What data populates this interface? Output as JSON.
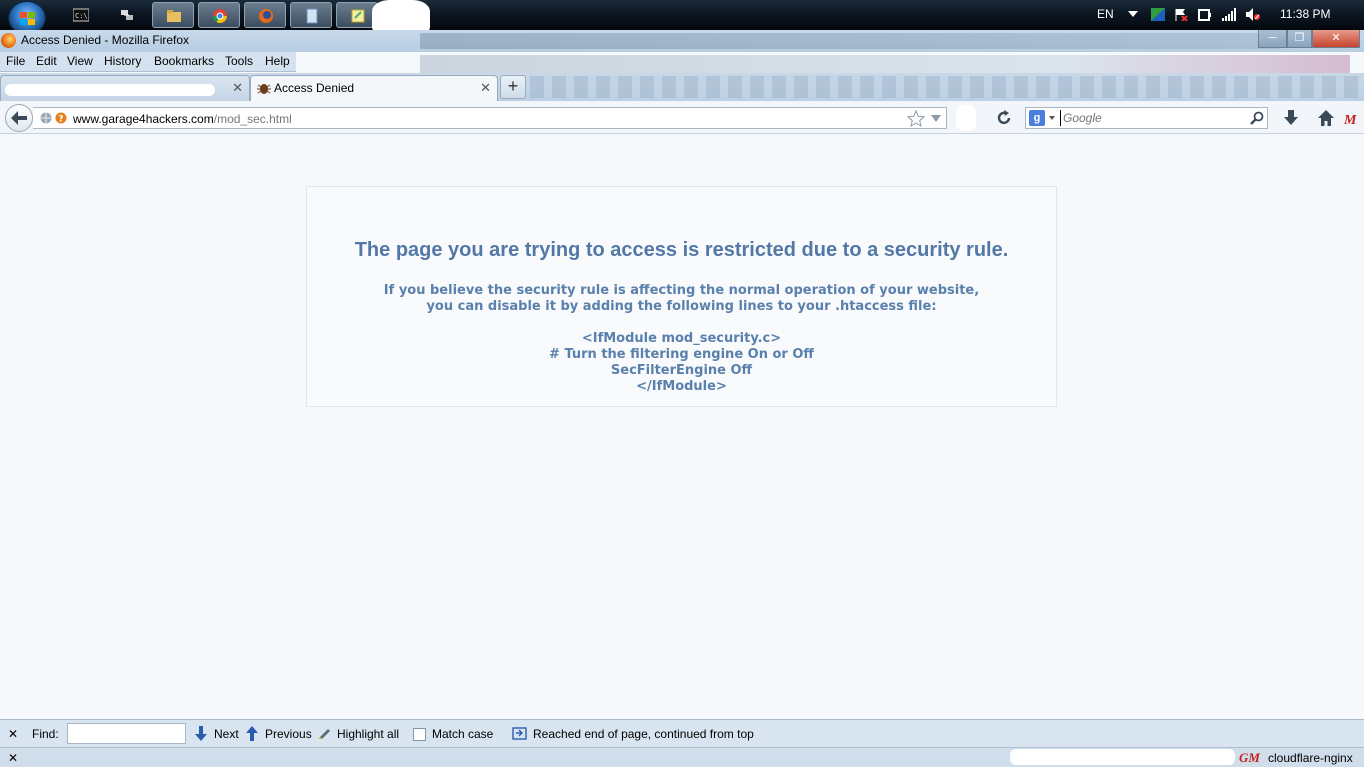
{
  "taskbar": {
    "language": "EN",
    "clock": "11:38 PM",
    "pinned_icons": [
      "cmd-icon",
      "network-tool-icon",
      "explorer-icon",
      "chrome-icon",
      "firefox-icon",
      "notepad-icon",
      "sticky-notes-icon"
    ]
  },
  "window": {
    "title": "Access Denied - Mozilla Firefox"
  },
  "menu": {
    "items": [
      "File",
      "Edit",
      "View",
      "History",
      "Bookmarks",
      "Tools",
      "Help"
    ]
  },
  "tabs": [
    {
      "label": "",
      "active": false
    },
    {
      "label": "Access Denied",
      "active": true
    }
  ],
  "navbar": {
    "url_domain": "www.garage4hackers.com",
    "url_path": "/mod_sec.html",
    "search_placeholder": "Google",
    "search_engine_letter": "g"
  },
  "page": {
    "heading": "The page you are trying to access is restricted due to a security rule.",
    "lines": [
      "If you believe the security rule is affecting the normal operation of your website,",
      "you can disable it by adding the following lines to your .htaccess file:",
      "<IfModule mod_security.c>",
      "# Turn the filtering engine On or Off",
      "SecFilterEngine Off",
      "</IfModule>"
    ]
  },
  "findbar": {
    "find_label": "Find:",
    "next_label": "Next",
    "previous_label": "Previous",
    "highlight_label": "Highlight all",
    "match_case_label": "Match case",
    "status_message": "Reached end of page, continued from top"
  },
  "statusbar": {
    "text": "cloudflare-nginx",
    "addon_glyph": "GM"
  }
}
